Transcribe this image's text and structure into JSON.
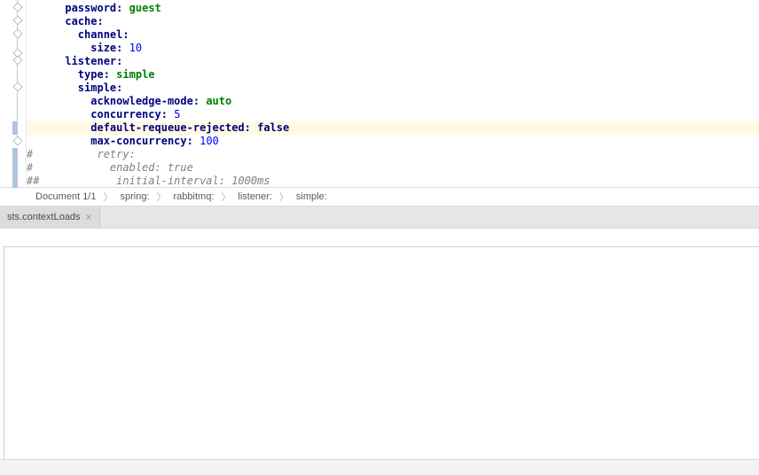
{
  "code": {
    "l1_key": "password",
    "l1_val": "guest",
    "l2_key": "cache",
    "l3_key": "channel",
    "l4_key": "size",
    "l4_val": "10",
    "l5_key": "listener",
    "l6_key": "type",
    "l6_val": "simple",
    "l7_key": "simple",
    "l8_key": "acknowledge-mode",
    "l8_val": "auto",
    "l9_key": "concurrency",
    "l9_val": "5",
    "l10_key": "default-requeue-rejected",
    "l10_val": "false",
    "l11_key": "max-concurrency",
    "l11_val": "100",
    "l12": "#          retry:",
    "l13": "#            enabled: true",
    "l14": "##            initial-interval: 1000ms"
  },
  "breadcrumb": {
    "doc": "Document 1/1",
    "p1": "spring:",
    "p2": "rabbitmq:",
    "p3": "listener:",
    "p4": "simple:"
  },
  "tab": {
    "label": "sts.contextLoads"
  }
}
